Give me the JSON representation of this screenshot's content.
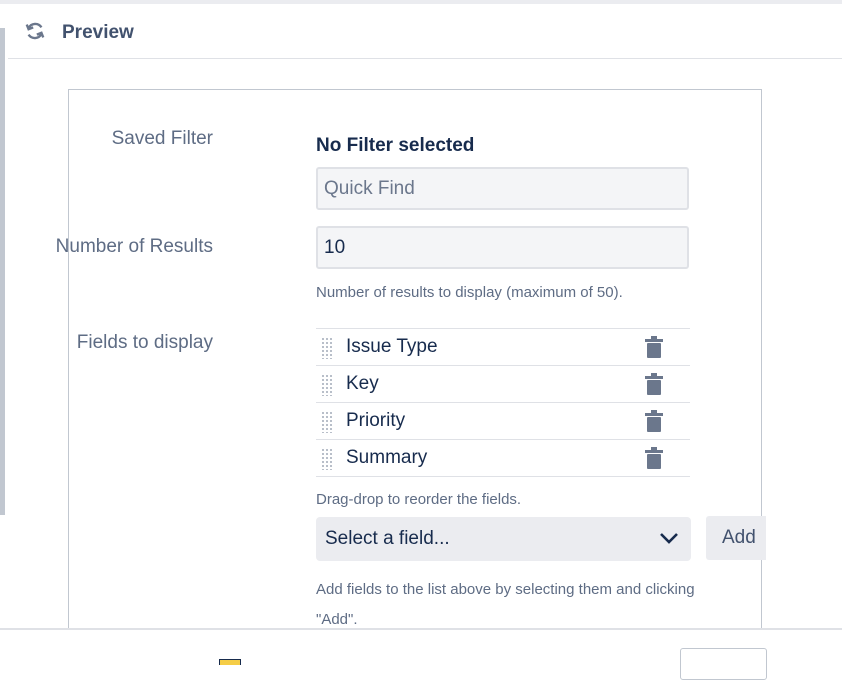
{
  "header": {
    "title": "Preview",
    "icon": "refresh-icon"
  },
  "form": {
    "saved_filter": {
      "label": "Saved Filter",
      "value": "No Filter selected",
      "search_placeholder": "Quick Find"
    },
    "number_of_results": {
      "label": "Number of Results",
      "value": "10",
      "help": "Number of results to display (maximum of 50)."
    },
    "fields_to_display": {
      "label": "Fields to display",
      "items": [
        {
          "label": "Issue Type"
        },
        {
          "label": "Key"
        },
        {
          "label": "Priority"
        },
        {
          "label": "Summary"
        }
      ],
      "reorder_help": "Drag-drop to reorder the fields.",
      "select_placeholder": "Select a field...",
      "add_label": "Add",
      "add_help": "Add fields to the list above by selecting them and clicking \"Add\"."
    }
  },
  "colors": {
    "label": "#5e6c84",
    "text": "#172b4d",
    "input_bg": "#f4f5f7",
    "border": "#dfe1e6",
    "icon": "#6b778c"
  }
}
